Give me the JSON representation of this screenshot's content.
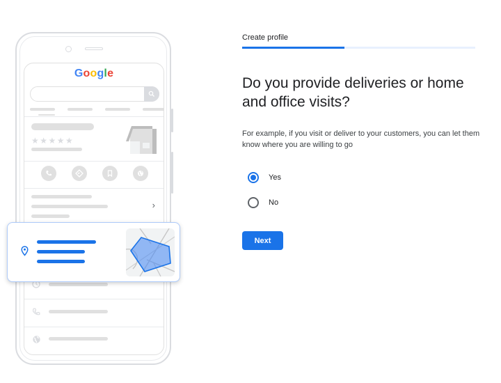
{
  "illustration": {
    "logo_letters": [
      {
        "char": "G",
        "color": "#4285f4"
      },
      {
        "char": "o",
        "color": "#ea4335"
      },
      {
        "char": "o",
        "color": "#fbbc05"
      },
      {
        "char": "g",
        "color": "#4285f4"
      },
      {
        "char": "l",
        "color": "#34a853"
      },
      {
        "char": "e",
        "color": "#ea4335"
      }
    ],
    "rating_stars": "★★★★★",
    "chevron": "›",
    "icons": [
      "search-icon",
      "storefront-icon",
      "phone-icon",
      "directions-icon",
      "bookmark-icon",
      "globe-icon",
      "location-pin-icon",
      "clock-icon",
      "map-area-icon"
    ]
  },
  "form": {
    "step_label": "Create profile",
    "progress_percent": 44,
    "question": "Do you provide deliveries or home and office visits?",
    "helper_text": "For example, if you visit or deliver to your customers, you can let them know where you are willing to go",
    "options": [
      {
        "label": "Yes",
        "selected": true
      },
      {
        "label": "No",
        "selected": false
      }
    ],
    "next_label": "Next"
  },
  "colors": {
    "accent": "#1a73e8",
    "progress_track": "#e8f0fe",
    "placeholder_gray": "#e0e0e0"
  }
}
